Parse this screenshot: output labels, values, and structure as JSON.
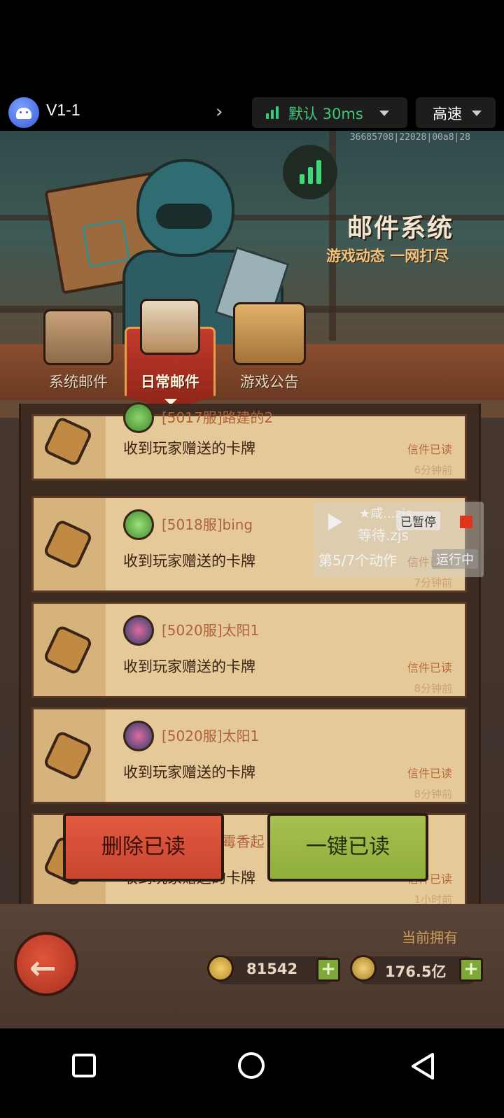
{
  "emulator": {
    "title": "V1-1",
    "network_label": "默认 30ms",
    "speed_label": "高速"
  },
  "game": {
    "id_text": "36685708|22028|00a8|28",
    "banner": {
      "title": "邮件系统",
      "subtitle": "游戏动态 一网打尽"
    },
    "tabs": [
      {
        "label": "系统邮件",
        "active": false
      },
      {
        "label": "日常邮件",
        "active": true
      },
      {
        "label": "游戏公告",
        "active": false
      }
    ],
    "mails": [
      {
        "sender": "[5017服]路建的2",
        "subject": "收到玩家赠送的卡牌",
        "status": "信件已读",
        "time": "6分钟前"
      },
      {
        "sender": "[5018服]bing",
        "subject": "收到玩家赠送的卡牌",
        "status": "信件已读",
        "time": "7分钟前"
      },
      {
        "sender": "[5020服]太阳1",
        "subject": "收到玩家赠送的卡牌",
        "status": "信件已读",
        "time": "8分钟前"
      },
      {
        "sender": "[5020服]太阳1",
        "subject": "收到玩家赠送的卡牌",
        "status": "信件已读",
        "time": "8分钟前"
      },
      {
        "sender": "[5017服]霉香起",
        "subject": "收到玩家赠送的卡牌",
        "status": "信件已读",
        "time": "1小时前"
      }
    ],
    "buttons": {
      "delete_read": "删除已读",
      "read_all": "一键已读"
    },
    "currency": {
      "label": "当前拥有",
      "cards": "81542",
      "coins": "176.5亿"
    }
  },
  "automation": {
    "script_name": "★咸...zjs",
    "paused_label": "已暂停",
    "script_file": "等待.zjs",
    "step": "第5/7个动作",
    "status": "运行中"
  },
  "icons": {
    "emulator": [
      "android-icon",
      "chevron-right-icon",
      "signal-bars-icon",
      "dropdown-arrow-icon"
    ],
    "game": [
      "signal-icon",
      "back-arrow-icon",
      "card-icon",
      "coin-icon",
      "plus-icon"
    ],
    "nav": [
      "recents-square-icon",
      "home-circle-icon",
      "back-triangle-icon"
    ]
  },
  "colors": {
    "accent_green": "#3fc97a",
    "delete_red": "#d44c36",
    "read_green": "#9ab646",
    "mail_paper": "#e6c999"
  }
}
